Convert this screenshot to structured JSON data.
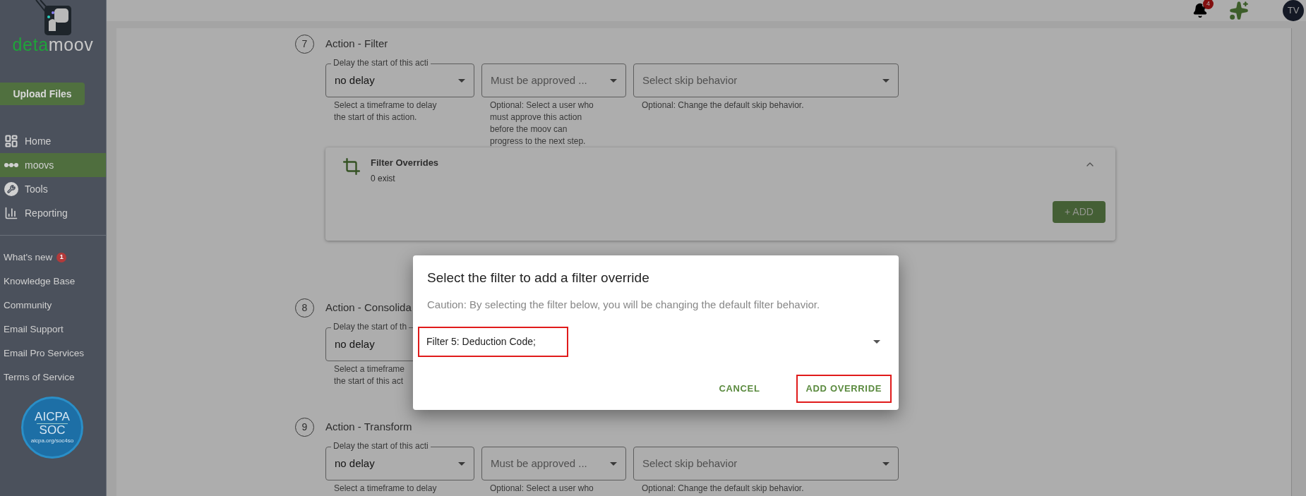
{
  "sidebar": {
    "logo": {
      "part_1": "deta",
      "part_2": "moov"
    },
    "upload_button": "Upload Files",
    "nav": [
      {
        "label": "Home",
        "selected": false
      },
      {
        "label": "moovs",
        "selected": true
      },
      {
        "label": "Tools",
        "selected": false
      },
      {
        "label": "Reporting",
        "selected": false
      }
    ],
    "links": [
      {
        "label": "What's new",
        "badge": "1"
      },
      {
        "label": "Knowledge Base"
      },
      {
        "label": "Community"
      },
      {
        "label": "Email Support"
      },
      {
        "label": "Email Pro Services"
      },
      {
        "label": "Terms of Service"
      }
    ],
    "certification": {
      "title": "AICPA",
      "subtitle": "SOC",
      "url": "aicpa.org/soc4so"
    }
  },
  "topbar": {
    "notifications_badge": "4",
    "avatar": "TV"
  },
  "steps": [
    {
      "number": "7",
      "title": "Action - Filter",
      "fields": [
        {
          "label": "Delay the start of this acti",
          "value": "no delay",
          "helper": "Select a timeframe to delay\nthe start of this action."
        },
        {
          "placeholder": "Must be approved ...",
          "helper": "Optional: Select a user who\nmust approve this action\nbefore the moov can\nprogress to the next step."
        },
        {
          "placeholder": "Select skip behavior",
          "helper": "Optional: Change the default skip behavior."
        }
      ],
      "overrides": {
        "title": "Filter Overrides",
        "count": "0 exist",
        "expanded": true,
        "add_button": "+ ADD"
      }
    },
    {
      "number": "8",
      "title": "Action - Consolida",
      "fields": [
        {
          "label": "Delay the start of th",
          "value": "no delay",
          "helper": "Select a timeframe\nthe start of this act"
        }
      ]
    },
    {
      "number": "9",
      "title": "Action - Transform",
      "fields": [
        {
          "label": "Delay the start of this acti",
          "value": "no delay",
          "helper": "Select a timeframe to delay"
        },
        {
          "placeholder": "Must be approved ...",
          "helper": "Optional: Select a user who"
        },
        {
          "placeholder": "Select skip behavior",
          "helper": "Optional: Change the default skip behavior."
        }
      ]
    }
  ],
  "dialog": {
    "title": "Select the filter to add a filter override",
    "caution": "Caution: By selecting the filter below, you will be changing the default filter behavior.",
    "select_value": "Filter 5: Deduction Code;",
    "buttons": [
      {
        "label": "CANCEL",
        "highlighted": false
      },
      {
        "label": "ADD OVERRIDE",
        "highlighted": true
      }
    ]
  }
}
